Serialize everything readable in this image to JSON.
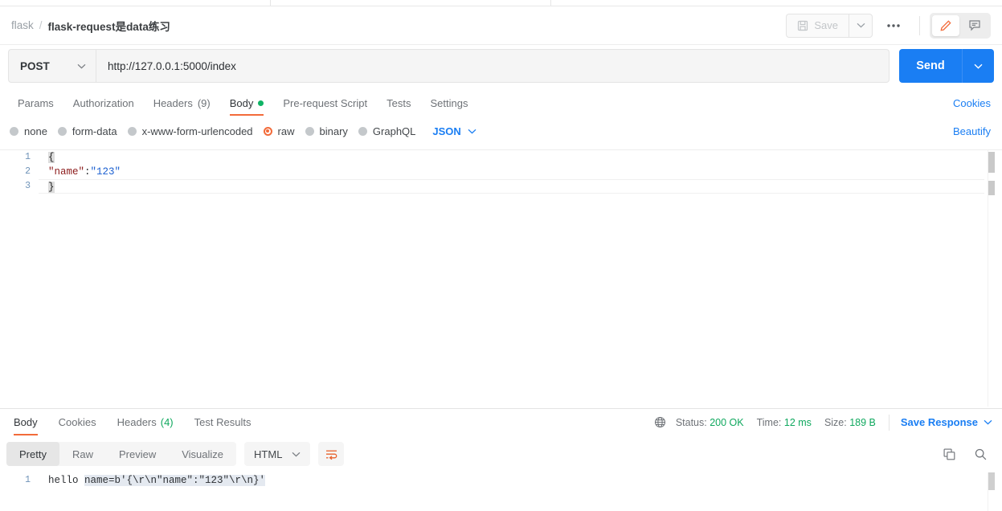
{
  "breadcrumb": {
    "root": "flask",
    "separator": "/",
    "name": "flask-request是data练习"
  },
  "header": {
    "save_label": "Save",
    "save_icon": "floppy-disk-icon",
    "save_caret_icon": "chevron-down-icon",
    "more_icon": "ooo",
    "edit_icon": "pencil-icon",
    "comment_icon": "comment-icon",
    "accent_orange": "#f26b3a"
  },
  "request": {
    "method": "POST",
    "method_caret_icon": "chevron-down-icon",
    "url": "http://127.0.0.1:5000/index",
    "url_placeholder": "Enter request URL",
    "send_label": "Send",
    "send_caret_icon": "chevron-down-icon",
    "send_color": "#1a7ef3"
  },
  "request_tabs": [
    {
      "label": "Params",
      "active": false,
      "dot": false,
      "count": ""
    },
    {
      "label": "Authorization",
      "active": false,
      "dot": false,
      "count": ""
    },
    {
      "label": "Headers",
      "active": false,
      "dot": false,
      "count": "(9)"
    },
    {
      "label": "Body",
      "active": true,
      "dot": true,
      "count": ""
    },
    {
      "label": "Pre-request Script",
      "active": false,
      "dot": false,
      "count": ""
    },
    {
      "label": "Tests",
      "active": false,
      "dot": false,
      "count": ""
    },
    {
      "label": "Settings",
      "active": false,
      "dot": false,
      "count": ""
    }
  ],
  "cookies_link": "Cookies",
  "body_types": [
    {
      "label": "none",
      "selected": false
    },
    {
      "label": "form-data",
      "selected": false
    },
    {
      "label": "x-www-form-urlencoded",
      "selected": false
    },
    {
      "label": "raw",
      "selected": true
    },
    {
      "label": "binary",
      "selected": false
    },
    {
      "label": "GraphQL",
      "selected": false
    }
  ],
  "body_format": "JSON",
  "body_format_caret_icon": "chevron-down-icon",
  "beautify_link": "Beautify",
  "editor": {
    "lines": [
      {
        "no": "1",
        "open_brace": "{"
      },
      {
        "no": "2",
        "key": "\"name\"",
        "colon": ":",
        "value": "\"123\""
      },
      {
        "no": "3",
        "close_brace": "}"
      }
    ]
  },
  "response_tabs": [
    {
      "label": "Body",
      "active": true,
      "count": ""
    },
    {
      "label": "Cookies",
      "active": false,
      "count": ""
    },
    {
      "label": "Headers",
      "active": false,
      "count": "(4)"
    },
    {
      "label": "Test Results",
      "active": false,
      "count": ""
    }
  ],
  "response_meta": {
    "globe_icon": "globe-icon",
    "status_label": "Status:",
    "status_value": "200 OK",
    "time_label": "Time:",
    "time_value": "12 ms",
    "size_label": "Size:",
    "size_value": "189 B",
    "save_response": "Save Response",
    "save_response_caret_icon": "chevron-down-icon",
    "ok_color": "#0fa85e"
  },
  "response_view_modes": [
    {
      "label": "Pretty",
      "active": true
    },
    {
      "label": "Raw",
      "active": false
    },
    {
      "label": "Preview",
      "active": false
    },
    {
      "label": "Visualize",
      "active": false
    }
  ],
  "response_format": "HTML",
  "response_format_caret_icon": "chevron-down-icon",
  "wrap_icon": "word-wrap-icon",
  "copy_icon": "copy-icon",
  "search_icon": "search-icon",
  "response_body": {
    "line_no": "1",
    "prefix": "hello ",
    "highlighted": "name=b'{\\r\\n\"name\":\"123\"\\r\\n}'"
  }
}
